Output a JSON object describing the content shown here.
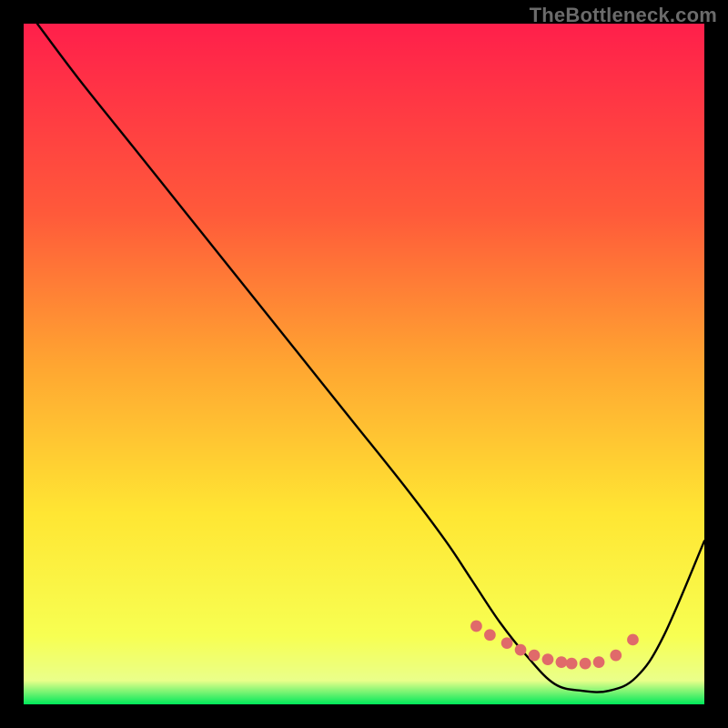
{
  "watermark": "TheBottleneck.com",
  "chart_data": {
    "type": "line",
    "title": "",
    "xlabel": "",
    "ylabel": "",
    "xlim": [
      0,
      100
    ],
    "ylim": [
      0,
      100
    ],
    "grid": false,
    "legend": false,
    "background_gradient_stops": [
      {
        "offset": 0.0,
        "color": "#ff1f4b"
      },
      {
        "offset": 0.28,
        "color": "#ff5a3a"
      },
      {
        "offset": 0.5,
        "color": "#ffa531"
      },
      {
        "offset": 0.72,
        "color": "#ffe633"
      },
      {
        "offset": 0.9,
        "color": "#f7ff52"
      },
      {
        "offset": 0.965,
        "color": "#eaff8a"
      },
      {
        "offset": 1.0,
        "color": "#00e85a"
      }
    ],
    "series": [
      {
        "name": "bottleneck-curve",
        "color": "#000000",
        "x": [
          2,
          8,
          16,
          24,
          32,
          40,
          48,
          56,
          62,
          66,
          70,
          74,
          78,
          82,
          86,
          90,
          94,
          100
        ],
        "y": [
          100,
          92,
          82,
          72,
          62,
          52,
          42,
          32,
          24,
          18,
          12,
          7,
          3,
          2,
          2,
          4,
          10,
          24
        ]
      }
    ],
    "markers": {
      "name": "curve-dots",
      "color": "#e06a6a",
      "radius_pct": 0.85,
      "x": [
        66.5,
        68.5,
        71,
        73,
        75,
        77,
        79,
        80.5,
        82.5,
        84.5,
        87,
        89.5
      ],
      "y": [
        11.5,
        10.2,
        9.0,
        8.0,
        7.2,
        6.6,
        6.2,
        6.0,
        6.0,
        6.2,
        7.2,
        9.5
      ]
    }
  }
}
